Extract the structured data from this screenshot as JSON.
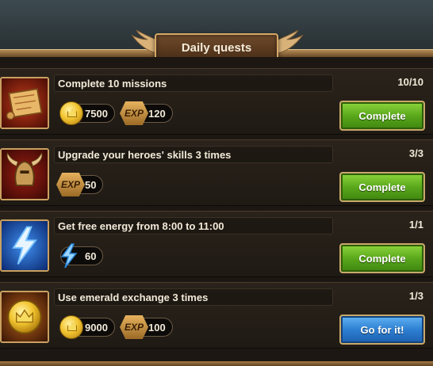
{
  "header": {
    "title": "Daily quests"
  },
  "quests": [
    {
      "title": "Complete 10 missions",
      "progress": "10/10",
      "icon": "scroll-map-icon",
      "rewards": [
        {
          "type": "gold",
          "value": "7500"
        },
        {
          "type": "exp",
          "label": "EXP",
          "value": "120"
        }
      ],
      "button": {
        "label": "Complete",
        "color": "#5aa81c"
      }
    },
    {
      "title": "Upgrade your heroes' skills 3 times",
      "progress": "3/3",
      "icon": "winged-helmet-icon",
      "rewards": [
        {
          "type": "exp",
          "label": "EXP",
          "value": "50"
        }
      ],
      "button": {
        "label": "Complete",
        "color": "#5aa81c"
      }
    },
    {
      "title": "Get free energy from 8:00 to 11:00",
      "progress": "1/1",
      "icon": "lightning-bolt-icon",
      "rewards": [
        {
          "type": "energy",
          "value": "60"
        }
      ],
      "button": {
        "label": "Complete",
        "color": "#5aa81c"
      }
    },
    {
      "title": "Use emerald exchange 3 times",
      "progress": "1/3",
      "icon": "gold-coin-icon",
      "rewards": [
        {
          "type": "gold",
          "value": "9000"
        },
        {
          "type": "exp",
          "label": "EXP",
          "value": "100"
        }
      ],
      "button": {
        "label": "Go for it!",
        "color": "#2d7fd2"
      }
    }
  ]
}
